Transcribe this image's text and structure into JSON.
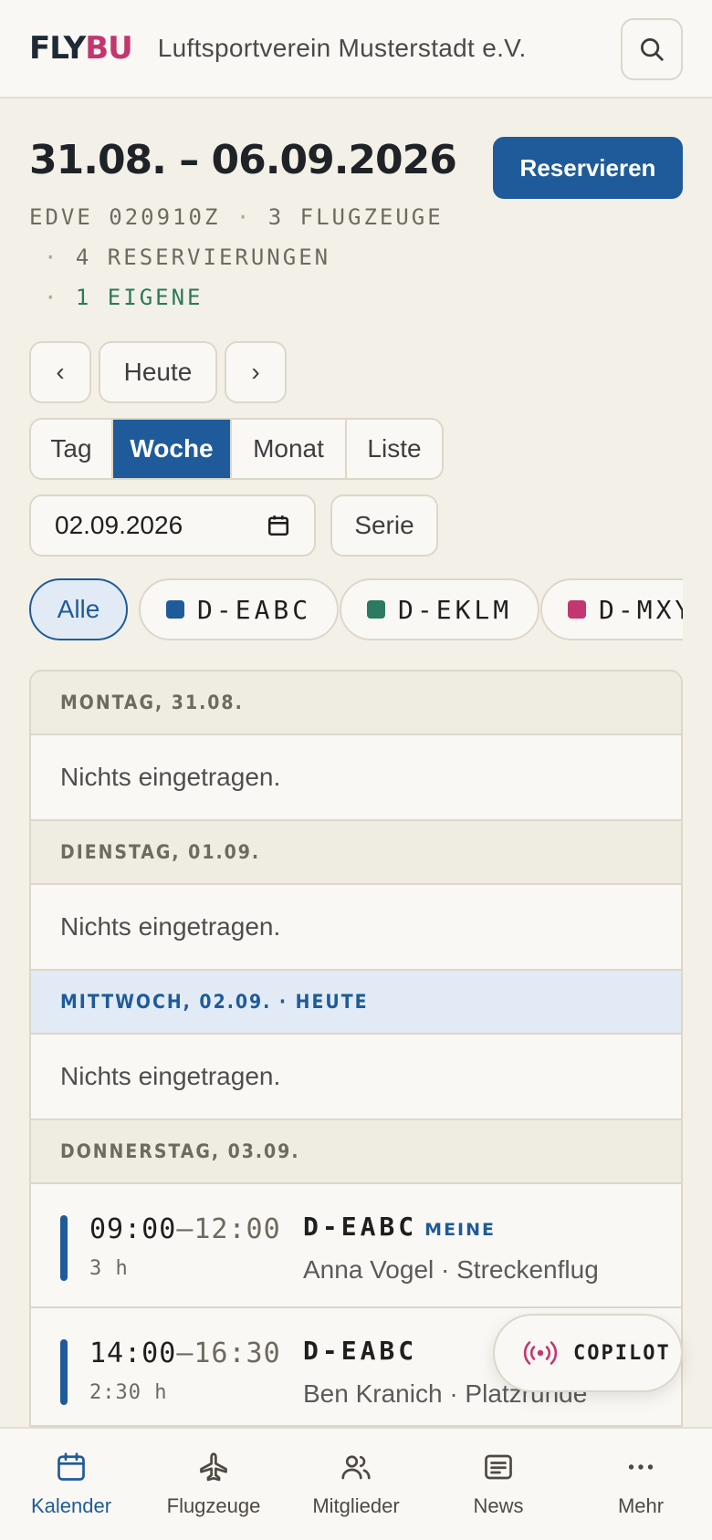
{
  "header": {
    "logo_part1": "FLY",
    "logo_part2": "BU",
    "club_name": "Luftsportverein Musterstadt e.V."
  },
  "title": {
    "date_range": "31.08. – 06.09.2026",
    "reserve_label": "Reservieren",
    "meta_line1_a": "EDVE 020910Z",
    "meta_line1_b": "3 FLUGZEUGE",
    "meta_line2": "4 RESERVIERUNGEN",
    "meta_line3": "1 EIGENE",
    "separator": "·"
  },
  "nav": {
    "prev": "‹",
    "today": "Heute",
    "next": "›"
  },
  "views": [
    "Tag",
    "Woche",
    "Monat",
    "Liste"
  ],
  "active_view": "Woche",
  "date_input": {
    "value": "02.09.2026"
  },
  "series_label": "Serie",
  "filters": {
    "all": "Alle",
    "aircraft": [
      {
        "reg": "D-EABC",
        "color": "#1f5b9a"
      },
      {
        "reg": "D-EKLM",
        "color": "#2b7a62"
      },
      {
        "reg": "D-MXY",
        "color": "#c2376f"
      }
    ]
  },
  "days": [
    {
      "label": "MONTAG, 31.08.",
      "empty": "Nichts eingetragen."
    },
    {
      "label": "DIENSTAG, 01.09.",
      "empty": "Nichts eingetragen."
    },
    {
      "label": "MITTWOCH, 02.09. · HEUTE",
      "empty": "Nichts eingetragen."
    },
    {
      "label": "DONNERSTAG, 03.09."
    }
  ],
  "entries": [
    {
      "start": "09:00",
      "end": "–12:00",
      "duration": "3 h",
      "reg": "D-EABC",
      "mine": "MEINE",
      "who": "Anna Vogel · Streckenflug"
    },
    {
      "start": "14:00",
      "end": "–16:30",
      "duration": "2:30 h",
      "reg": "D-EABC",
      "who": "Ben Kranich · Platzrunde"
    }
  ],
  "copilot_label": "COPILOT",
  "bottom_nav": {
    "calendar": "Kalender",
    "aircraft": "Flugzeuge",
    "members": "Mitglieder",
    "news": "News",
    "more": "Mehr"
  }
}
